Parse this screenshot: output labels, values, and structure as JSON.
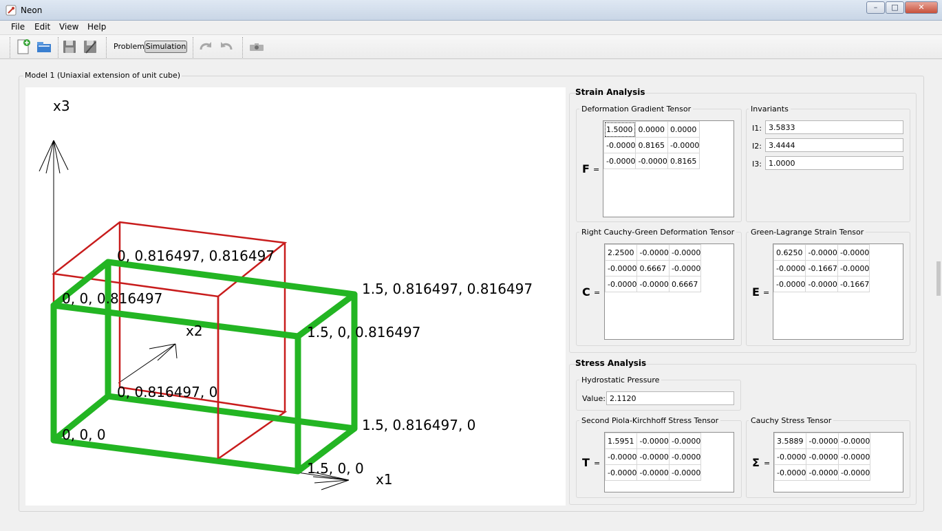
{
  "window": {
    "title": "Neon",
    "controls": {
      "minimize": "–",
      "maximize": "□",
      "close": "✕"
    }
  },
  "menu": [
    "File",
    "Edit",
    "View",
    "Help"
  ],
  "toolbar": {
    "problem_label": "Problem",
    "simulation_label": "Simulation"
  },
  "model": {
    "title": "Model 1 (Uniaxial extension of unit cube)",
    "axes": {
      "x1": "x1",
      "x2": "x2",
      "x3": "x3"
    },
    "vertex_labels": {
      "v000": "0, 0, 0",
      "v100": "1.5, 0, 0",
      "v010": "0, 0.816497, 0",
      "v110": "1.5, 0.816497, 0",
      "v001": "0, 0, 0.816497",
      "v101": "1.5, 0, 0.816497",
      "v011": "0, 0.816497, 0.816497",
      "v111": "1.5, 0.816497, 0.816497"
    },
    "colors": {
      "deformed": "#1fb21f",
      "undeformed": "#c81c1c"
    }
  },
  "strain": {
    "title": "Strain Analysis",
    "F": {
      "title": "Deformation Gradient Tensor",
      "symbol": "F",
      "rows": [
        [
          "1.5000",
          "0.0000",
          "0.0000"
        ],
        [
          "-0.0000",
          "0.8165",
          "-0.0000"
        ],
        [
          "-0.0000",
          "-0.0000",
          "0.8165"
        ]
      ]
    },
    "invariants": {
      "title": "Invariants",
      "items": [
        {
          "label": "I1:",
          "value": "3.5833"
        },
        {
          "label": "I2:",
          "value": "3.4444"
        },
        {
          "label": "I3:",
          "value": "1.0000"
        }
      ]
    },
    "C": {
      "title": "Right Cauchy-Green Deformation Tensor",
      "symbol": "C",
      "rows": [
        [
          "2.2500",
          "-0.0000",
          "-0.0000"
        ],
        [
          "-0.0000",
          "0.6667",
          "-0.0000"
        ],
        [
          "-0.0000",
          "-0.0000",
          "0.6667"
        ]
      ]
    },
    "E": {
      "title": "Green-Lagrange Strain Tensor",
      "symbol": "E",
      "rows": [
        [
          "0.6250",
          "-0.0000",
          "-0.0000"
        ],
        [
          "-0.0000",
          "-0.1667",
          "-0.0000"
        ],
        [
          "-0.0000",
          "-0.0000",
          "-0.1667"
        ]
      ]
    }
  },
  "stress": {
    "title": "Stress Analysis",
    "pressure": {
      "title": "Hydrostatic Pressure",
      "label": "Value:",
      "value": "2.1120"
    },
    "T": {
      "title": "Second Piola-Kirchhoff Stress Tensor",
      "symbol": "T",
      "rows": [
        [
          "1.5951",
          "-0.0000",
          "-0.0000"
        ],
        [
          "-0.0000",
          "-0.0000",
          "-0.0000"
        ],
        [
          "-0.0000",
          "-0.0000",
          "-0.0000"
        ]
      ]
    },
    "Sigma": {
      "title": "Cauchy Stress Tensor",
      "symbol": "Σ",
      "rows": [
        [
          "3.5889",
          "-0.0000",
          "-0.0000"
        ],
        [
          "-0.0000",
          "-0.0000",
          "-0.0000"
        ],
        [
          "-0.0000",
          "-0.0000",
          "-0.0000"
        ]
      ]
    }
  }
}
